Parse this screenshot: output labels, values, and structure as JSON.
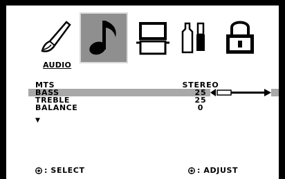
{
  "menu": {
    "tabs": [
      {
        "name": "picture",
        "icon": "paintbrush-icon"
      },
      {
        "name": "audio",
        "icon": "music-note-icon"
      },
      {
        "name": "setup",
        "icon": "tv-icon"
      },
      {
        "name": "features",
        "icon": "tools-icon"
      },
      {
        "name": "lock",
        "icon": "padlock-icon"
      }
    ],
    "active_tab": "audio",
    "section_title": "AUDIO"
  },
  "settings": [
    {
      "label": "MTS",
      "value": "STEREO"
    },
    {
      "label": "BASS",
      "value": "25"
    },
    {
      "label": "TREBLE",
      "value": "25"
    },
    {
      "label": "BALANCE",
      "value": "0"
    }
  ],
  "bass_slider": {
    "level": 0.5
  },
  "more_indicator": "▼",
  "footer": {
    "select_label": ": SELECT",
    "adjust_label": ": ADJUST"
  },
  "colors": {
    "highlight": "#a8a8a8",
    "active_tab": "#8f8f8f",
    "frame": "#000000"
  }
}
